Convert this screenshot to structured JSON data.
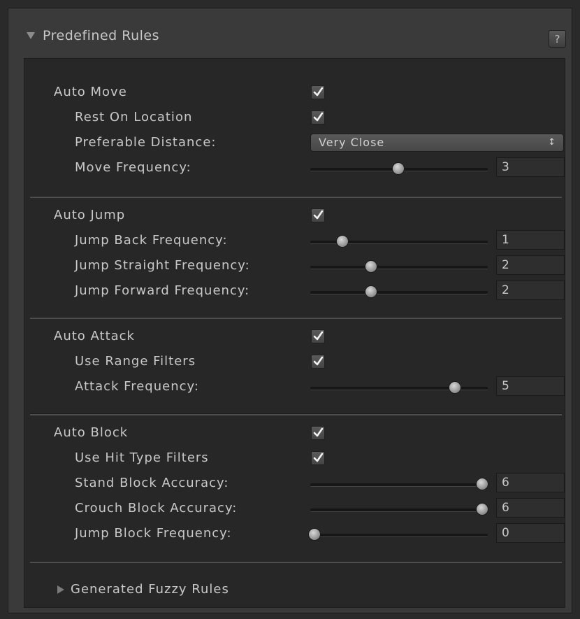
{
  "panel": {
    "title": "Predefined Rules",
    "help_label": "?"
  },
  "sections": {
    "move": {
      "auto_label": "Auto Move",
      "auto_checked": true,
      "rest_label": "Rest On Location",
      "rest_checked": true,
      "distance_label": "Preferable Distance:",
      "distance_value": "Very Close",
      "move_freq_label": "Move Frequency:",
      "move_freq_value": "3"
    },
    "jump": {
      "auto_label": "Auto Jump",
      "auto_checked": true,
      "back_label": "Jump Back Frequency:",
      "back_value": "1",
      "straight_label": "Jump Straight Frequency:",
      "straight_value": "2",
      "forward_label": "Jump Forward Frequency:",
      "forward_value": "2"
    },
    "attack": {
      "auto_label": "Auto Attack",
      "auto_checked": true,
      "range_label": "Use Range Filters",
      "range_checked": true,
      "freq_label": "Attack Frequency:",
      "freq_value": "5"
    },
    "block": {
      "auto_label": "Auto Block",
      "auto_checked": true,
      "hit_label": "Use Hit Type Filters",
      "hit_checked": true,
      "stand_label": "Stand Block Accuracy:",
      "stand_value": "6",
      "crouch_label": "Crouch Block Accuracy:",
      "crouch_value": "6",
      "jump_label": "Jump Block Frequency:",
      "jump_value": "0"
    }
  },
  "fuzzy": {
    "label": "Generated Fuzzy Rules"
  },
  "icons": {
    "header_fold": "triangle-down-icon",
    "fuzzy_fold": "triangle-right-icon",
    "checkmark": "checkmark-icon",
    "dropdown_caret": "updown-caret-icon"
  },
  "colors": {
    "background": "#2a2a2a",
    "panel": "#3a3a3a",
    "inner": "#272727",
    "text": "#c8c8c8"
  }
}
